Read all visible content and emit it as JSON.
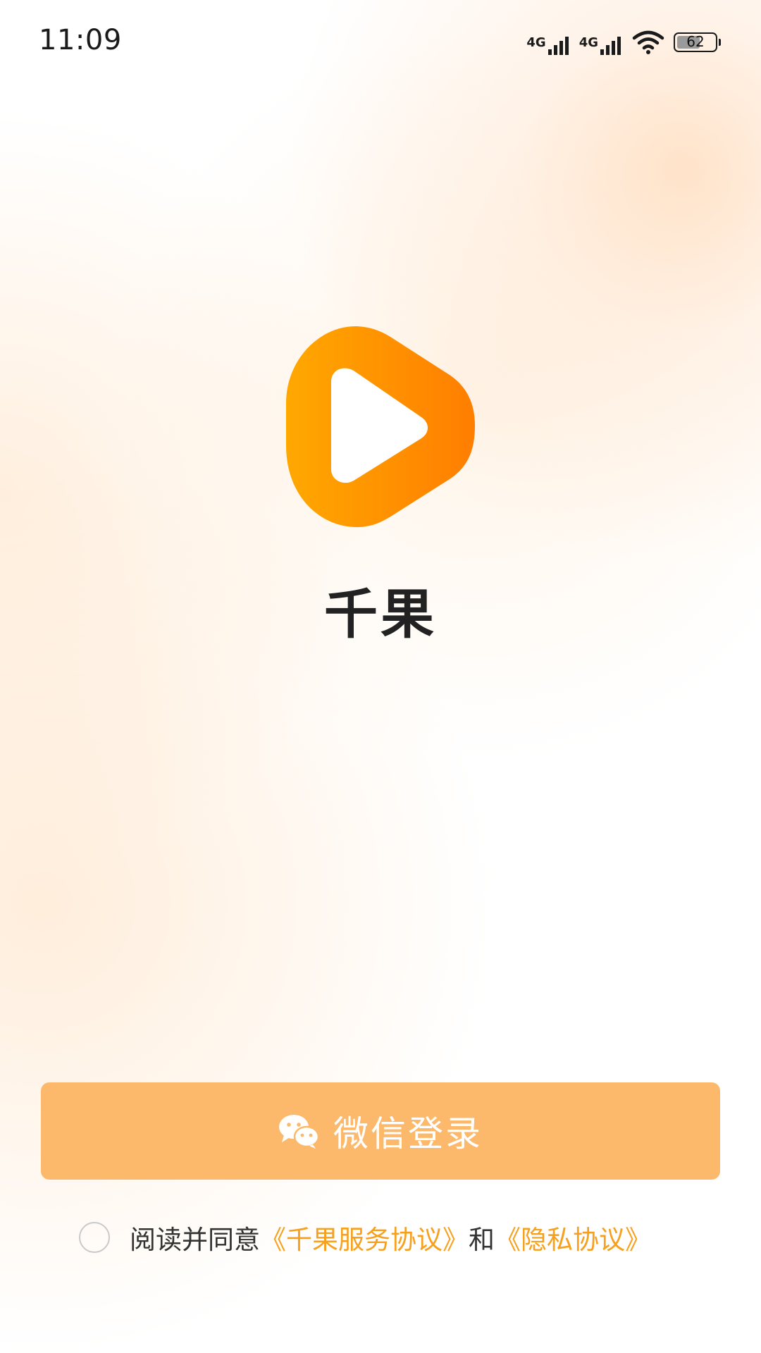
{
  "status_bar": {
    "time": "11:09",
    "signal1_label": "4G",
    "signal2_label": "4G",
    "battery_level": 62,
    "battery_text": "62",
    "icons": [
      "signal-4g-icon",
      "signal-4g-icon",
      "wifi-icon",
      "battery-icon"
    ]
  },
  "app": {
    "name": "千果",
    "logo_icon": "play-logo-icon",
    "logo_colors": [
      "#FFA800",
      "#FF7E00"
    ]
  },
  "login": {
    "button_label": "微信登录",
    "icon": "wechat-icon",
    "button_color": "#FDB96B"
  },
  "agreement": {
    "checked": false,
    "prefix": "阅读并同意",
    "service_link": "《千果服务协议》",
    "conjunction": "和",
    "privacy_link": "《隐私协议》",
    "link_color": "#F7A01E"
  }
}
